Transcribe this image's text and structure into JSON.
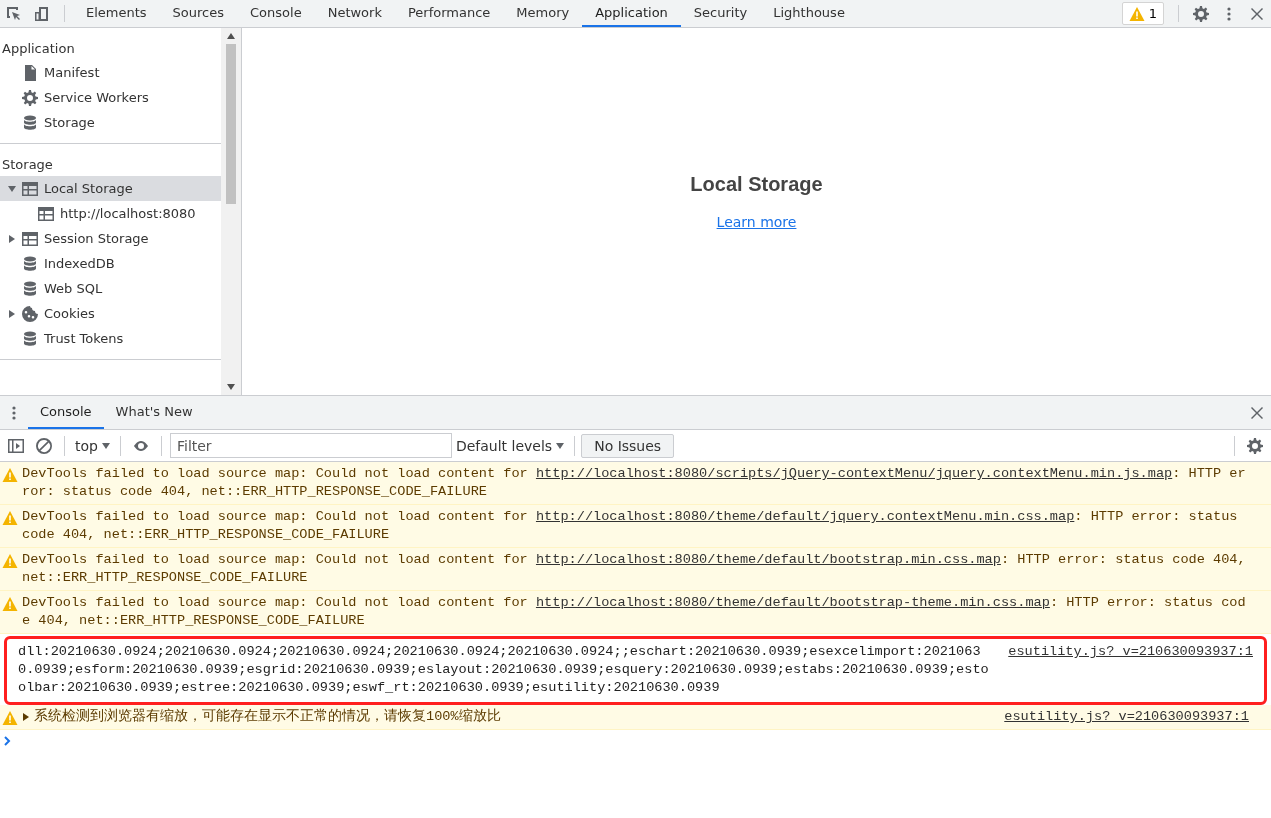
{
  "toolbar": {
    "tabs": [
      {
        "label": "Elements",
        "selected": false
      },
      {
        "label": "Sources",
        "selected": false
      },
      {
        "label": "Console",
        "selected": false
      },
      {
        "label": "Network",
        "selected": false
      },
      {
        "label": "Performance",
        "selected": false
      },
      {
        "label": "Memory",
        "selected": false
      },
      {
        "label": "Application",
        "selected": true
      },
      {
        "label": "Security",
        "selected": false
      },
      {
        "label": "Lighthouse",
        "selected": false
      }
    ],
    "warning_count": "1"
  },
  "sidebar": {
    "sections": [
      {
        "title": "Application",
        "items": [
          {
            "label": "Manifest",
            "kind": "file",
            "selected": false
          },
          {
            "label": "Service Workers",
            "kind": "gear",
            "selected": false
          },
          {
            "label": "Storage",
            "kind": "database",
            "selected": false
          }
        ]
      },
      {
        "title": "Storage",
        "items": [
          {
            "label": "Local Storage",
            "kind": "table",
            "selected": true,
            "expanded": true,
            "children": [
              {
                "label": "http://localhost:8080",
                "kind": "table",
                "selected": false
              }
            ]
          },
          {
            "label": "Session Storage",
            "kind": "table",
            "selected": false,
            "expanded": false
          },
          {
            "label": "IndexedDB",
            "kind": "database",
            "selected": false
          },
          {
            "label": "Web SQL",
            "kind": "database",
            "selected": false
          },
          {
            "label": "Cookies",
            "kind": "cookie",
            "selected": false,
            "expanded": false
          },
          {
            "label": "Trust Tokens",
            "kind": "database",
            "selected": false
          }
        ]
      }
    ]
  },
  "main": {
    "heading": "Local Storage",
    "link": "Learn more"
  },
  "drawer": {
    "tabs": [
      {
        "label": "Console",
        "selected": true
      },
      {
        "label": "What's New",
        "selected": false
      }
    ],
    "context": "top",
    "filter": {
      "placeholder": "Filter"
    },
    "levels": "Default levels",
    "issues": "No Issues",
    "messages": [
      {
        "kind": "warning",
        "before": "DevTools failed to load source map: Could not load content for ",
        "url": "http://localhost:8080/scripts/jQuery-contextMenu/jquery.contextMenu.min.js.map",
        "after": ": HTTP error: status code 404, net::ERR_HTTP_RESPONSE_CODE_FAILURE"
      },
      {
        "kind": "warning",
        "before": "DevTools failed to load source map: Could not load content for ",
        "url": "http://localhost:8080/theme/default/jquery.contextMenu.min.css.map",
        "after": ": HTTP error: status code 404, net::ERR_HTTP_RESPONSE_CODE_FAILURE"
      },
      {
        "kind": "warning",
        "before": "DevTools failed to load source map: Could not load content for ",
        "url": "http://localhost:8080/theme/default/bootstrap.min.css.map",
        "after": ": HTTP error: status code 404, net::ERR_HTTP_RESPONSE_CODE_FAILURE"
      },
      {
        "kind": "warning",
        "before": "DevTools failed to load source map: Could not load content for ",
        "url": "http://localhost:8080/theme/default/bootstrap-theme.min.css.map",
        "after": ": HTTP error: status code 404, net::ERR_HTTP_RESPONSE_CODE_FAILURE"
      },
      {
        "kind": "log",
        "highlighted": true,
        "source": "esutility.js?_v=210630093937:1",
        "before": "dll:20210630.0924;20210630.0924;20210630.0924;20210630.0924;20210630.0924;;eschart:20210630.0939;esexcelimport:20210630.0939;esform:20210630.0939;esgrid:20210630.0939;eslayout:20210630.0939;esquery:20210630.0939;estabs:20210630.0939;estoolbar:20210630.0939;estree:20210630.0939;eswf_rt:20210630.0939;esutility:20210630.0939"
      },
      {
        "kind": "warning",
        "expanded": false,
        "source": "esutility.js?_v=210630093937:1",
        "before": "系统检测到浏览器有缩放，可能存在显示不正常的情况，请恢复100%缩放比"
      }
    ]
  }
}
